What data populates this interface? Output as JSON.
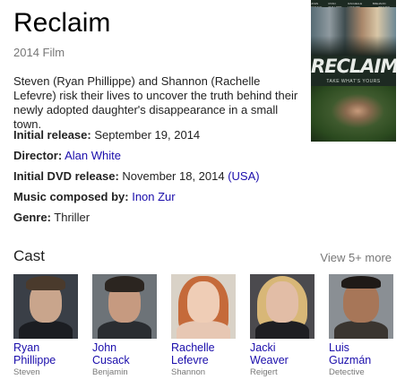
{
  "title": "Reclaim",
  "subtitle": "2014 Film",
  "description": "Steven (Ryan Phillippe) and Shannon (Rachelle Lefevre) risk their lives to uncover the truth behind their newly adopted daughter's disappearance in a small town.",
  "poster": {
    "title": "RECLAIM",
    "tagline": "TAKE WHAT'S YOURS",
    "credits": [
      "JOHN CUSACK",
      "RYAN PHILLIPPE",
      "RACHELLE LEFEVRE",
      "BRE",
      "JACKI WEAVER"
    ]
  },
  "facts": {
    "initial_release": {
      "label": "Initial release:",
      "value": "September 19, 2014"
    },
    "director": {
      "label": "Director:",
      "value": "Alan White"
    },
    "dvd_release": {
      "label": "Initial DVD release:",
      "value": "November 18, 2014",
      "region": "(USA)"
    },
    "music": {
      "label": "Music composed by:",
      "value": "Inon Zur"
    },
    "genre": {
      "label": "Genre:",
      "value": "Thriller"
    }
  },
  "cast": {
    "heading": "Cast",
    "view_more": "View 5+ more",
    "members": [
      {
        "name_line1": "Ryan",
        "name_line2": "Phillippe",
        "role": "Steven"
      },
      {
        "name_line1": "John",
        "name_line2": "Cusack",
        "role": "Benjamin"
      },
      {
        "name_line1": "Rachelle",
        "name_line2": "Lefevre",
        "role": "Shannon"
      },
      {
        "name_line1": "Jacki",
        "name_line2": "Weaver",
        "role": "Reigert"
      },
      {
        "name_line1": "Luis",
        "name_line2": "Guzmán",
        "role": "Detective"
      }
    ]
  }
}
